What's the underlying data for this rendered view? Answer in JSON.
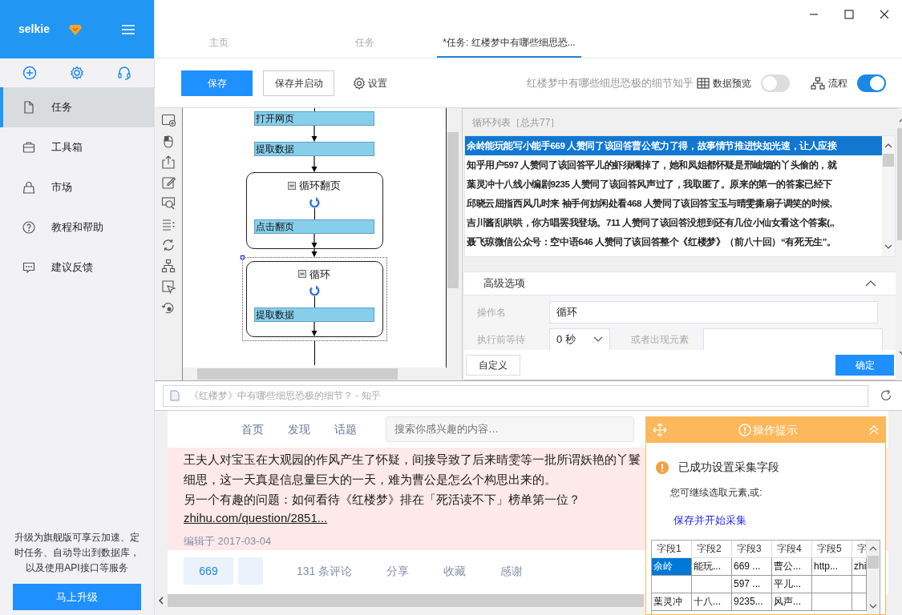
{
  "app": {
    "name": "selkie"
  },
  "sidebar": {
    "items": [
      {
        "label": "任务",
        "selected": true
      },
      {
        "label": "工具箱",
        "selected": false
      },
      {
        "label": "市场",
        "selected": false
      },
      {
        "label": "教程和帮助",
        "selected": false
      },
      {
        "label": "建议反馈",
        "selected": false
      }
    ],
    "promo": "升级为旗舰版可享云加速、定时任务、自动导出到数据库，以及使用API接口等服务",
    "upgrade_button": "马上升级"
  },
  "tabs": [
    {
      "label": "主页",
      "selected": false
    },
    {
      "label": "任务",
      "selected": false
    },
    {
      "label": "*任务: 红楼梦中有哪些细思恐...",
      "selected": true
    }
  ],
  "toolbar": {
    "buttons": [
      "保存",
      "保存并启动"
    ],
    "settings": "设置",
    "task_title": "红楼梦中有哪些细思恐极的细节知乎",
    "toggles": [
      {
        "label": "数据预览",
        "on": false
      },
      {
        "label": "流程",
        "on": true
      }
    ]
  },
  "flow": {
    "nodes": [
      {
        "kind": "step",
        "label": "打开网页"
      },
      {
        "kind": "step",
        "label": "提取数据"
      },
      {
        "kind": "loop",
        "label": "循环翻页",
        "selected": false,
        "children": [
          {
            "kind": "step",
            "label": "点击翻页"
          }
        ]
      },
      {
        "kind": "loop",
        "label": "循环",
        "selected": true,
        "children": [
          {
            "kind": "step",
            "label": "提取数据"
          }
        ]
      }
    ]
  },
  "loop_list": {
    "title": "循环列表［总共77］",
    "items": [
      {
        "text": "余岭能玩能写小能手669  人赞同了该回答曹公笔力了得，故事情节推进快如光速，让人应接",
        "selected": true
      },
      {
        "text": "知乎用户597  人赞同了该回答平儿的虾须镯掉了，她和凤姐都怀疑是邢岫烟的丫头偷的，就",
        "selected": false
      },
      {
        "text": "葉灵冲十八线小编剧9235  人赞同了该回答风声过了，我取匿了。原来的第一的答案已经下",
        "selected": false
      },
      {
        "text": "邱晓云屈指西风几时来  袖手何妨闲处看468  人赞同了该回答宝玉与晴雯撕扇子调笑的时候,",
        "selected": false
      },
      {
        "text": "吉川酱乱哄哄，你方唱罢我登场。711  人赞同了该回答没想到还有几位小仙女看这个答案(,,",
        "selected": false
      },
      {
        "text": "聂飞琼微信公众号：空中语646  人赞同了该回答整个《红楼梦》（前八十回）“有死无生”。",
        "selected": false
      }
    ]
  },
  "advanced": {
    "title": "高级选项",
    "expanded": true,
    "fields": [
      {
        "label": "操作名",
        "kind": "text",
        "value": "循环"
      },
      {
        "label": "执行前等待",
        "kind": "select",
        "value": "0 秒"
      },
      {
        "label": "或者出现元素",
        "kind": "text"
      }
    ],
    "buttons": [
      "自定义",
      "确定"
    ]
  },
  "browser": {
    "address": "《红楼梦》中有哪些细思恐极的细节？ - 知乎",
    "nav": [
      "首页",
      "发现",
      "话题"
    ],
    "search_placeholder": "搜索你感兴趣的内容…",
    "paragraphs": [
      "王夫人对宝玉在大观园的作风产生了怀疑，间接导致了后来晴雯等一批所谓妖艳的丫鬟",
      "细思，这一天真是信息量巨大的一天，难为曹公是怎么个构思出来的。",
      "另一个有趣的问题：如何看待《红楼梦》排在「死活读不下」榜单第一位？"
    ],
    "link": "zhihu.com/question/2851...",
    "edited": "编辑于 2017-03-04",
    "votes": "669",
    "actions": [
      "131 条评论",
      "分享",
      "收藏",
      "感谢"
    ]
  },
  "tip": {
    "title": "操作提示",
    "message": "已成功设置采集字段",
    "hint": "您可继续选取元素,或:",
    "link": "保存并开始采集",
    "columns": [
      "字段1",
      "字段2",
      "字段3",
      "字段4",
      "字段5",
      "字"
    ],
    "rows": [
      {
        "cells": [
          {
            "text": "余岭",
            "selected": true
          },
          {
            "text": "能玩...",
            "selected": false
          },
          {
            "text": "669 ...",
            "selected": false
          },
          {
            "text": "曹公...",
            "selected": false
          },
          {
            "text": "http...",
            "selected": false
          },
          {
            "text": "zhi",
            "selected": false
          }
        ]
      },
      {
        "cells": [
          {
            "selected": false
          },
          {
            "selected": false
          },
          {
            "text": "597 ...",
            "selected": false
          },
          {
            "text": "平儿...",
            "selected": false
          },
          {
            "selected": false
          },
          {
            "selected": false
          }
        ]
      },
      {
        "cells": [
          {
            "text": "葉灵冲",
            "selected": false
          },
          {
            "text": "十八...",
            "selected": false
          },
          {
            "text": "9235...",
            "selected": false
          },
          {
            "text": "风声...",
            "selected": false
          },
          {
            "selected": false
          },
          {
            "selected": false
          }
        ]
      }
    ]
  }
}
